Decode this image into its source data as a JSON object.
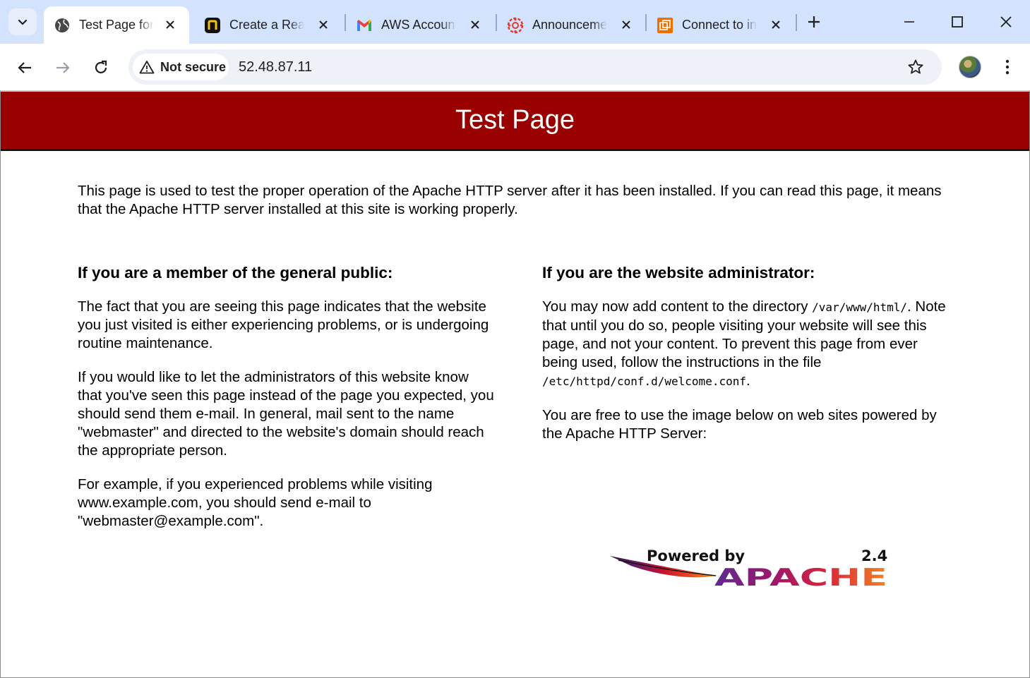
{
  "browser": {
    "tabs": [
      {
        "title": "Test Page for",
        "active": true,
        "icon": "globe-icon"
      },
      {
        "title": "Create a Read",
        "active": false,
        "icon": "nutanix-icon"
      },
      {
        "title": "AWS Account",
        "active": false,
        "icon": "gmail-icon"
      },
      {
        "title": "Announceme",
        "active": false,
        "icon": "canvas-icon"
      },
      {
        "title": "Connect to in",
        "active": false,
        "icon": "aws-ec2-icon"
      }
    ],
    "security_label": "Not secure",
    "url": "52.48.87.11"
  },
  "page": {
    "banner_title": "Test Page",
    "intro": "This page is used to test the proper operation of the Apache HTTP server after it has been installed. If you can read this page, it means that the Apache HTTP server installed at this site is working properly.",
    "public": {
      "heading": "If you are a member of the general public:",
      "p1": "The fact that you are seeing this page indicates that the website you just visited is either experiencing problems, or is undergoing routine maintenance.",
      "p2": "If you would like to let the administrators of this website know that you've seen this page instead of the page you expected, you should send them e-mail. In general, mail sent to the name \"webmaster\" and directed to the website's domain should reach the appropriate person.",
      "p3": "For example, if you experienced problems while visiting www.example.com, you should send e-mail to \"webmaster@example.com\"."
    },
    "admin": {
      "heading": "If you are the website administrator:",
      "p1_a": "You may now add content to the directory ",
      "p1_dir": "/var/www/html/",
      "p1_b": ". Note that until you do so, people visiting your website will see this page, and not your content. To prevent this page from ever being used, follow the instructions in the file ",
      "p1_file": "/etc/httpd/conf.d/welcome.conf",
      "p1_c": ".",
      "p2": "You are free to use the image below on web sites powered by the Apache HTTP Server:"
    },
    "logo": {
      "powered_by": "Powered by",
      "version": "2.4",
      "name": "APACHE"
    }
  }
}
